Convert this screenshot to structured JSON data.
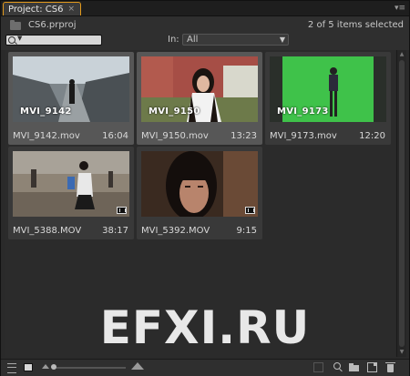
{
  "tab": {
    "title": "Project: CS6",
    "close_glyph": "×"
  },
  "panel_menu_glyph": "▾≡",
  "header": {
    "project_file": "CS6.prproj",
    "selection_status": "2 of 5 items selected",
    "in_label": "In:",
    "in_value": "All",
    "search_dropdown_glyph": "▼",
    "in_dropdown_glyph": "▼"
  },
  "clips": [
    {
      "name": "MVI_9142.mov",
      "duration": "16:04",
      "overlay": "MVI_9142",
      "selected": true
    },
    {
      "name": "MVI_9150.mov",
      "duration": "13:23",
      "overlay": "MVI_9150",
      "selected": true
    },
    {
      "name": "MVI_9173.mov",
      "duration": "12:20",
      "overlay": "MVI_9173",
      "selected": false
    },
    {
      "name": "MVI_5388.MOV",
      "duration": "38:17",
      "overlay": "",
      "selected": false
    },
    {
      "name": "MVI_5392.MOV",
      "duration": "9:15",
      "overlay": "",
      "selected": false
    }
  ],
  "scroll_glyphs": {
    "up": "▲",
    "down": "▼"
  },
  "watermark": "EFXI.RU",
  "colors": {
    "accent": "#e39a1c",
    "selected_tile": "#575757",
    "tile": "#393939"
  }
}
